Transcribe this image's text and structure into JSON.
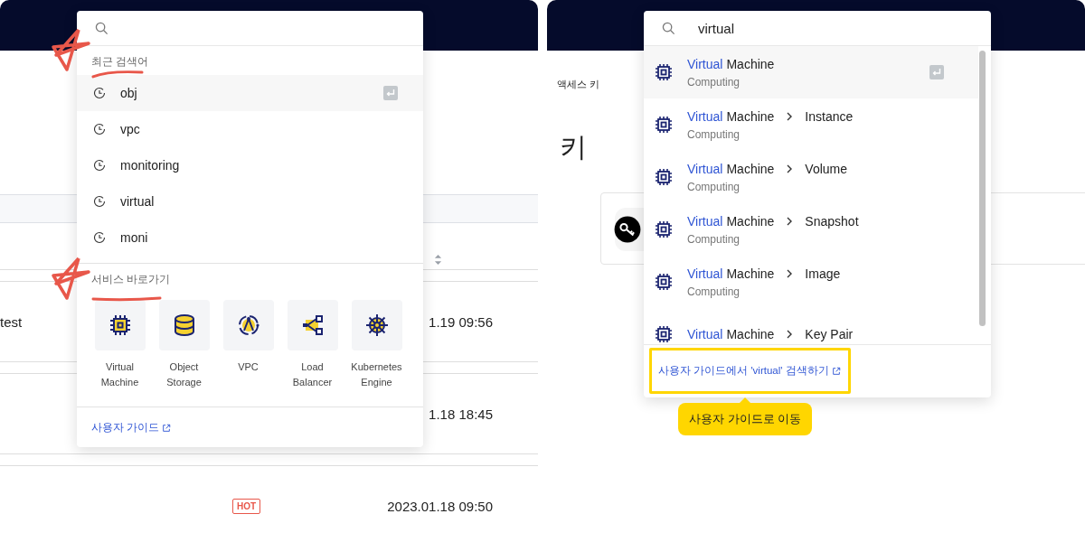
{
  "left": {
    "table": {
      "rows": [
        {
          "name": "test",
          "date": "1.19 09:56"
        },
        {
          "date": "1.18 18:45"
        },
        {
          "badge": "HOT",
          "date": "2023.01.18 09:50"
        }
      ]
    },
    "recent_title": "최근 검색어",
    "recent": [
      {
        "label": "obj",
        "selected": true
      },
      {
        "label": "vpc",
        "selected": false
      },
      {
        "label": "monitoring",
        "selected": false
      },
      {
        "label": "virtual",
        "selected": false
      },
      {
        "label": "moni",
        "selected": false
      }
    ],
    "shortcuts_title": "서비스 바로가기",
    "shortcuts": [
      {
        "kind": "chip",
        "label": "Virtual Machine"
      },
      {
        "kind": "database",
        "label": "Object Storage"
      },
      {
        "kind": "globe",
        "label": "VPC"
      },
      {
        "kind": "network",
        "label": "Load Balancer"
      },
      {
        "kind": "wheel",
        "label": "Kubernetes Engine"
      }
    ],
    "guide_link": "사용자 가이드"
  },
  "right": {
    "breadcrumb": "액세스 키",
    "heading": "키",
    "search": {
      "value": "virtual"
    },
    "results": [
      {
        "match": "Virtual",
        "name": "Machine",
        "category": "Computing",
        "selected": true
      },
      {
        "match": "Virtual",
        "name": "Machine",
        "sub": "Instance",
        "category": "Computing",
        "selected": false
      },
      {
        "match": "Virtual",
        "name": "Machine",
        "sub": "Volume",
        "category": "Computing",
        "selected": false
      },
      {
        "match": "Virtual",
        "name": "Machine",
        "sub": "Snapshot",
        "category": "Computing",
        "selected": false
      },
      {
        "match": "Virtual",
        "name": "Machine",
        "sub": "Image",
        "category": "Computing",
        "selected": false
      },
      {
        "match": "Virtual",
        "name": "Machine",
        "sub": "Key Pair",
        "selected": false
      }
    ],
    "guide_search_link": "사용자 가이드에서 'virtual' 검색하기",
    "tooltip": "사용자 가이드로 이동"
  }
}
